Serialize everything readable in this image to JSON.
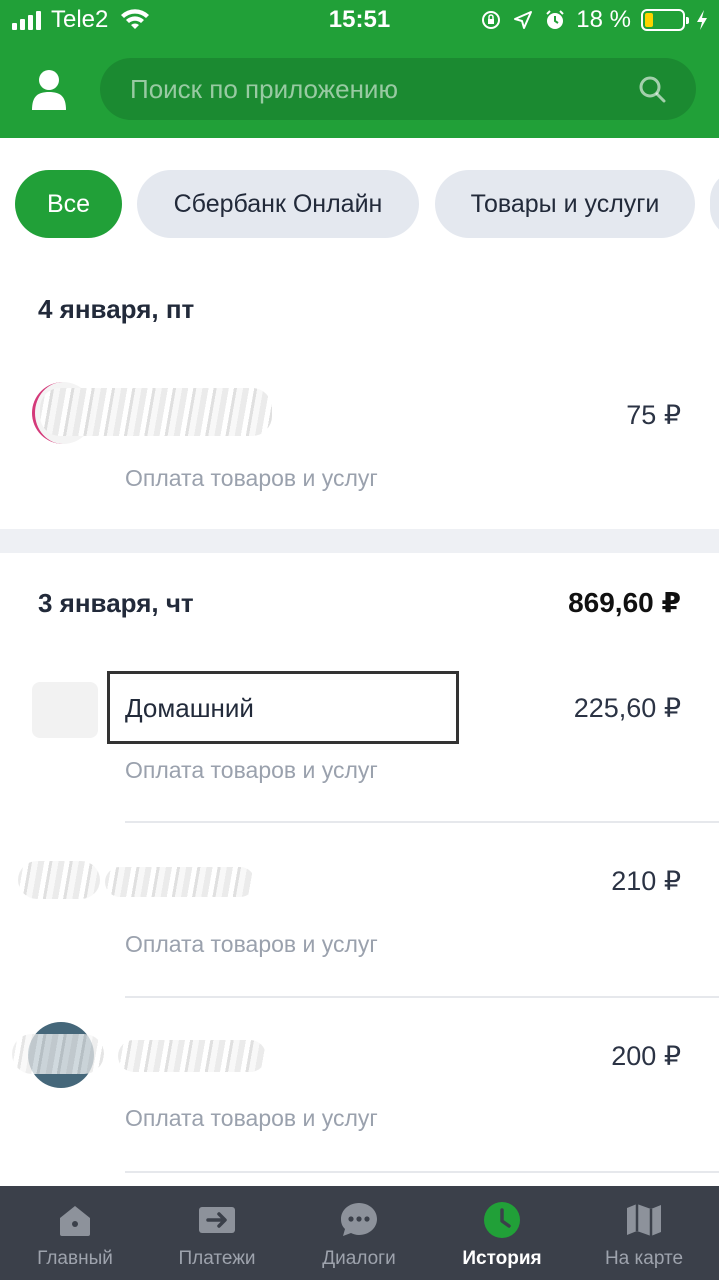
{
  "status_bar": {
    "carrier": "Tele2",
    "time": "15:51",
    "battery_percent": "18 %",
    "icons": [
      "signal-icon",
      "wifi-icon",
      "orientation-lock-icon",
      "location-icon",
      "alarm-icon",
      "battery-icon",
      "charging-bolt-icon"
    ]
  },
  "header": {
    "search_placeholder": "Поиск по приложению",
    "profile_icon": "user-icon",
    "search_icon": "search-icon",
    "brand_color": "#21a038"
  },
  "filters": [
    {
      "label": "Все",
      "active": true
    },
    {
      "label": "Сбербанк Онлайн",
      "active": false
    },
    {
      "label": "Товары и услуги",
      "active": false
    }
  ],
  "days": [
    {
      "title": "4 января, пт",
      "total": "",
      "transactions": [
        {
          "name": "",
          "subtitle": "Оплата товаров и услуг",
          "amount": "75 ₽"
        }
      ]
    },
    {
      "title": "3 января, чт",
      "total": "869,60 ₽",
      "transactions": [
        {
          "name": "Домашний",
          "subtitle": "Оплата товаров и услуг",
          "amount": "225,60 ₽"
        },
        {
          "name": "",
          "subtitle": "Оплата товаров и услуг",
          "amount": "210 ₽"
        },
        {
          "name": "",
          "subtitle": "Оплата товаров и услуг",
          "amount": "200 ₽"
        }
      ]
    }
  ],
  "tabbar": {
    "items": [
      {
        "label": "Главный",
        "icon": "home-icon",
        "active": false
      },
      {
        "label": "Платежи",
        "icon": "payments-icon",
        "active": false
      },
      {
        "label": "Диалоги",
        "icon": "chat-icon",
        "active": false
      },
      {
        "label": "История",
        "icon": "clock-icon",
        "active": true
      },
      {
        "label": "На карте",
        "icon": "map-icon",
        "active": false
      }
    ]
  }
}
